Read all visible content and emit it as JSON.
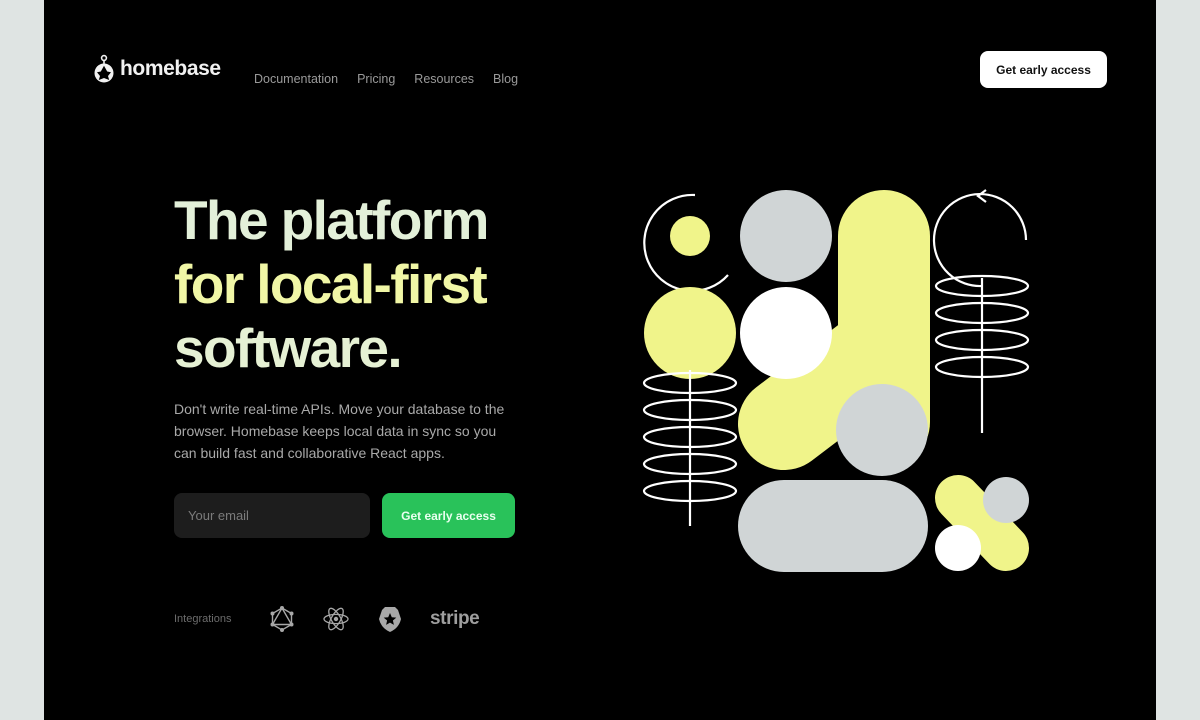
{
  "brand": {
    "name": "homebase"
  },
  "nav": {
    "links": [
      {
        "label": "Documentation"
      },
      {
        "label": "Pricing"
      },
      {
        "label": "Resources"
      },
      {
        "label": "Blog"
      }
    ],
    "cta_label": "Get early access"
  },
  "hero": {
    "headline": [
      "The platform",
      "for local-first",
      "software."
    ],
    "subtitle": "Don't write real-time APIs. Move your database to the browser. Homebase keeps local data in sync so you can build fast and collaborative React apps.",
    "email_placeholder": "Your email",
    "cta_label": "Get early access"
  },
  "integrations": {
    "label": "Integrations",
    "items": [
      {
        "icon": "graphql-icon"
      },
      {
        "icon": "react-icon"
      },
      {
        "icon": "auth0-icon"
      },
      {
        "text": "stripe"
      }
    ]
  },
  "colors": {
    "background": "#000000",
    "accent_yellow": "#f0f48a",
    "accent_grey": "#d0d5d6",
    "accent_white": "#ffffff",
    "accent_green": "#29c25a"
  }
}
